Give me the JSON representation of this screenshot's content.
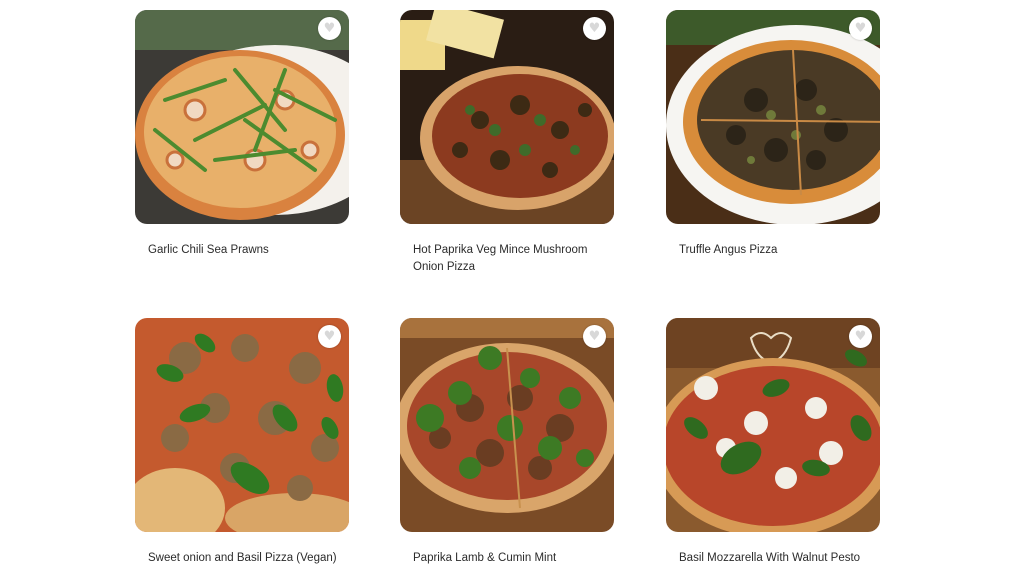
{
  "menu": {
    "items": [
      {
        "name": "Garlic Chili Sea Prawns",
        "image_icon": "pizza-seafood-arugula-image",
        "favorite_icon": "heart-icon",
        "favorite_glyph": "♥"
      },
      {
        "name": "Hot Paprika Veg Mince Mushroom Onion Pizza",
        "image_icon": "pizza-veg-mince-image",
        "favorite_icon": "heart-icon",
        "favorite_glyph": "♥"
      },
      {
        "name": "Truffle Angus Pizza",
        "image_icon": "pizza-truffle-angus-image",
        "favorite_icon": "heart-icon",
        "favorite_glyph": "♥"
      },
      {
        "name": "Sweet onion and Basil Pizza (Vegan)",
        "image_icon": "pizza-basil-onion-image",
        "favorite_icon": "heart-icon",
        "favorite_glyph": "♥"
      },
      {
        "name": "Paprika Lamb & Cumin Mint",
        "image_icon": "pizza-lamb-mint-image",
        "favorite_icon": "heart-icon",
        "favorite_glyph": "♥"
      },
      {
        "name": "Basil Mozzarella With Walnut Pesto",
        "image_icon": "pizza-mozzarella-basil-image",
        "favorite_icon": "heart-icon",
        "favorite_glyph": "♥"
      }
    ]
  },
  "colors": {
    "title_text": "#2b2b2b",
    "favorite_button_bg": "#ffffff",
    "favorite_icon": "#d8d8d8",
    "page_bg": "#ffffff"
  }
}
